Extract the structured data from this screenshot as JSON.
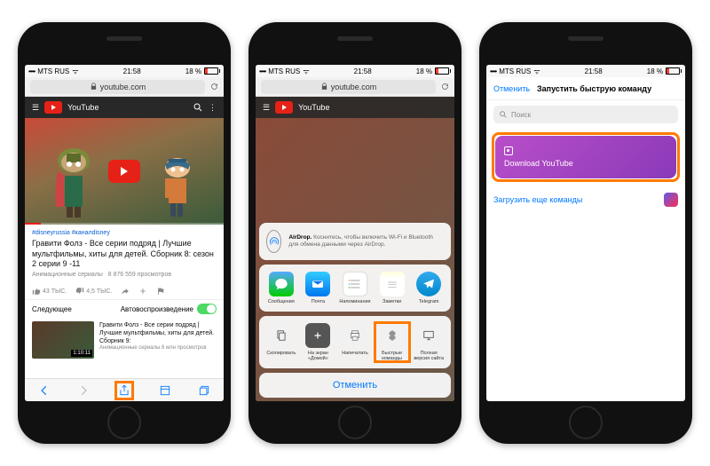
{
  "status": {
    "carrier": "MTS RUS",
    "wifi": "ᯤ",
    "time": "21:58",
    "battery_pct": "18 %"
  },
  "url": "youtube.com",
  "phone1": {
    "yt_label": "YouTube",
    "tags": "#disneyrussia  #каналdisney",
    "title": "Гравити Фолз - Все серии подряд | Лучшие мультфильмы, хиты для детей. Сборник 8: сезон 2 серии 9 -11",
    "channel": "Анимационные сериалы",
    "views": "8 876 559 просмотров",
    "likes": "43 ТЫС.",
    "dislikes": "4,5 ТЫС.",
    "next_label": "Следующее",
    "autoplay_label": "Автовоспроизведение",
    "thumb_time": "1:10:11",
    "thumb_title": "Гравити Фолз - Все серии подряд | Лучшие мультфильмы, хиты для детей. Сборник 9:",
    "thumb_sub": "Анимационные сериалы\n8 млн просмотров"
  },
  "phone2": {
    "airdrop_bold": "AirDrop.",
    "airdrop_text": " Коснитесь, чтобы включить Wi-Fi и Bluetooth для обмена данными через AirDrop.",
    "apps": [
      "Сообщения",
      "Почта",
      "Напоминания",
      "Заметки",
      "Telegram"
    ],
    "actions": [
      "Скопировать",
      "На экран «Домой»",
      "Напечатать",
      "Быстрые команды",
      "Полная версия сайта"
    ],
    "cancel": "Отменить"
  },
  "phone3": {
    "cancel": "Отменить",
    "title": "Запустить быструю команду",
    "search": "Поиск",
    "card": "Download YouTube",
    "more": "Загрузить еще команды"
  }
}
